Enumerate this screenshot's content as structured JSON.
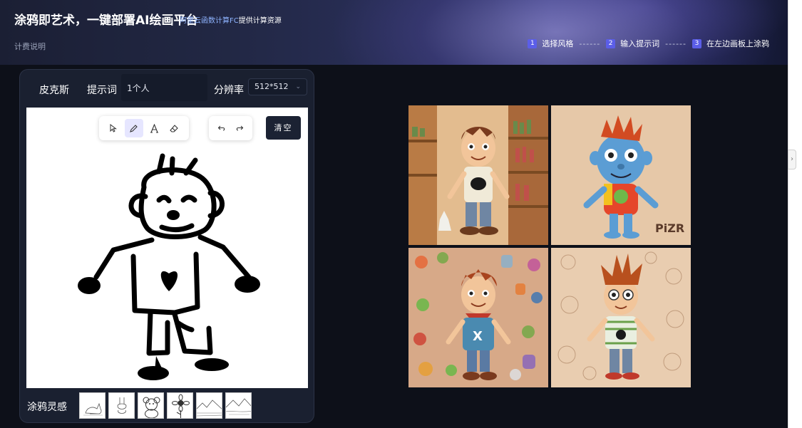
{
  "header": {
    "title": "涂鸦即艺术，一键部署AI绘画平台",
    "link_prefix": "阿里云函数计算FC",
    "link_suffix": "提供计算资源",
    "billing": "计费说明",
    "steps": [
      {
        "num": "1",
        "label": "选择风格"
      },
      {
        "num": "2",
        "label": "输入提示词"
      },
      {
        "num": "3",
        "label": "在左边画板上涂鸦"
      }
    ],
    "step_separator": "------"
  },
  "panel": {
    "style_name": "皮克斯",
    "prompt_label": "提示词",
    "prompt_value": "1个人",
    "resolution_label": "分辨率",
    "resolution_value": "512*512",
    "clear_label": "清空",
    "inspiration_label": "涂鸦灵感"
  },
  "tools": [
    "select-icon",
    "pencil-icon",
    "text-icon",
    "eraser-icon",
    "undo-icon",
    "redo-icon"
  ],
  "inspiration_thumbs": [
    "cat-sketch",
    "rabbit-sketch",
    "bear-sketch",
    "sunflower-sketch",
    "landscape-sketch",
    "mountain-sketch"
  ],
  "results": [
    "pixar-boy-bookshelf",
    "blue-creature",
    "boy-with-monsters",
    "boy-sketch-style"
  ],
  "colors": {
    "accent": "#5b5ee8",
    "bg": "#0d1019",
    "panel": "#1a2030"
  }
}
